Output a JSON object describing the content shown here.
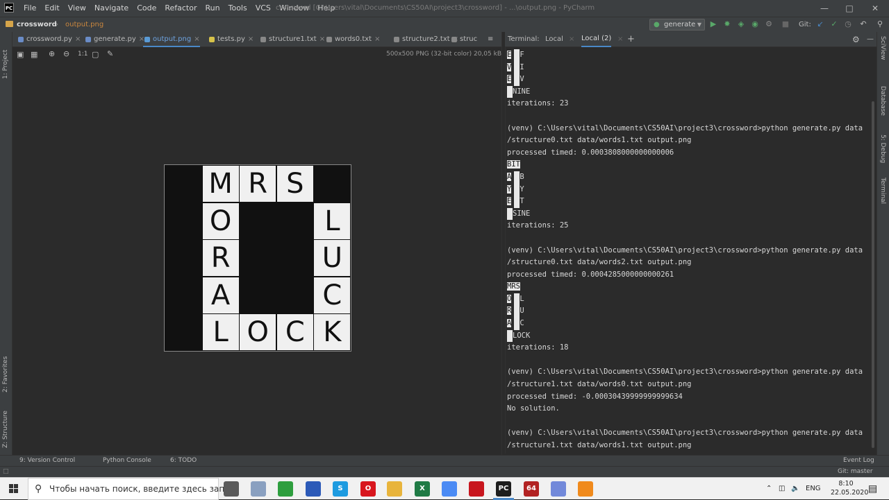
{
  "colors": {
    "accent": "#4a88c7",
    "run_green": "#59a869",
    "warning_red": "#c75450",
    "folder_orange": "#d6a54a"
  },
  "title_bar": {
    "logo": "PC",
    "menu": [
      "File",
      "Edit",
      "View",
      "Navigate",
      "Code",
      "Refactor",
      "Run",
      "Tools",
      "VCS",
      "Window",
      "Help"
    ],
    "window_title": "crossword [C:\\Users\\vital\\Documents\\CS50AI\\project3\\crossword] - ...\\output.png - PyCharm",
    "icons": [
      "minimize-icon",
      "maximize-icon",
      "close-icon"
    ]
  },
  "navbar": {
    "project": "crossword",
    "file": "output.png",
    "run_config": "generate",
    "vcs_label": "Git:"
  },
  "left_strip": {
    "project": "1: Project",
    "favorites": "2: Favorites",
    "structure": "Z: Structure"
  },
  "right_strip": {
    "sciview": "SciView",
    "database": "Database",
    "debug": "5: Debug",
    "terminal": "Terminal"
  },
  "editor_tabs": [
    {
      "label": "crossword.py",
      "icon_color": "#6a8cc7"
    },
    {
      "label": "generate.py",
      "icon_color": "#6a8cc7"
    },
    {
      "label": "output.png",
      "icon_color": "#5a9bd6"
    },
    {
      "label": "tests.py",
      "icon_color": "#d6c24a"
    },
    {
      "label": "structure1.txt",
      "icon_color": "#888888"
    },
    {
      "label": "words0.txt",
      "icon_color": "#888888"
    },
    {
      "label": "structure2.txt",
      "icon_color": "#888888"
    },
    {
      "label": "struc",
      "icon_color": "#888888"
    }
  ],
  "viewer": {
    "image_info": "500x500 PNG (32-bit color) 20,05 kB",
    "zoom_label": "1:1",
    "grid": [
      [
        "",
        "M",
        "R",
        "S",
        ""
      ],
      [
        "",
        "O",
        "",
        "",
        "L"
      ],
      [
        "",
        "R",
        "",
        "",
        "U"
      ],
      [
        "",
        "A",
        "",
        "",
        "C"
      ],
      [
        "",
        "L",
        "O",
        "C",
        "K"
      ]
    ]
  },
  "terminal": {
    "tab_title": "Terminal:",
    "tabs": [
      "Local",
      "Local (2)"
    ],
    "lines": [
      {
        "t": "cells",
        "cells": [
          [
            "E",
            1
          ],
          [
            "",
            1
          ],
          [
            "F",
            0
          ]
        ]
      },
      {
        "t": "cells",
        "cells": [
          [
            "V",
            1
          ],
          [
            "",
            1
          ],
          [
            "I",
            0
          ]
        ]
      },
      {
        "t": "cells",
        "cells": [
          [
            "E",
            1
          ],
          [
            "",
            1
          ],
          [
            "V",
            0
          ]
        ]
      },
      {
        "t": "cells",
        "cells": [
          [
            "",
            1
          ],
          [
            "NINE",
            0
          ]
        ]
      },
      {
        "t": "text",
        "text": "iterations: 23"
      },
      {
        "t": "text",
        "text": ""
      },
      {
        "t": "text",
        "text": "(venv) C:\\Users\\vital\\Documents\\CS50AI\\project3\\crossword>python generate.py data"
      },
      {
        "t": "text",
        "text": "/structure0.txt data/words1.txt output.png"
      },
      {
        "t": "text",
        "text": "processed timed: 0.0003808000000000006"
      },
      {
        "t": "cells",
        "cells": [
          [
            "BIT",
            1
          ]
        ]
      },
      {
        "t": "cells",
        "cells": [
          [
            "A",
            1
          ],
          [
            "",
            1
          ],
          [
            "B",
            0
          ]
        ]
      },
      {
        "t": "cells",
        "cells": [
          [
            "Y",
            1
          ],
          [
            "",
            1
          ],
          [
            "Y",
            0
          ]
        ]
      },
      {
        "t": "cells",
        "cells": [
          [
            "E",
            1
          ],
          [
            "",
            1
          ],
          [
            "T",
            0
          ]
        ]
      },
      {
        "t": "cells",
        "cells": [
          [
            "",
            1
          ],
          [
            "SINE",
            0
          ]
        ]
      },
      {
        "t": "text",
        "text": "iterations: 25"
      },
      {
        "t": "text",
        "text": ""
      },
      {
        "t": "text",
        "text": "(venv) C:\\Users\\vital\\Documents\\CS50AI\\project3\\crossword>python generate.py data"
      },
      {
        "t": "text",
        "text": "/structure0.txt data/words2.txt output.png"
      },
      {
        "t": "text",
        "text": "processed timed: 0.0004285000000000261"
      },
      {
        "t": "cells",
        "cells": [
          [
            "MRS",
            1
          ]
        ]
      },
      {
        "t": "cells",
        "cells": [
          [
            "O",
            1
          ],
          [
            "",
            1
          ],
          [
            "L",
            0
          ]
        ]
      },
      {
        "t": "cells",
        "cells": [
          [
            "R",
            1
          ],
          [
            "",
            1
          ],
          [
            "U",
            0
          ]
        ]
      },
      {
        "t": "cells",
        "cells": [
          [
            "A",
            1
          ],
          [
            "",
            1
          ],
          [
            "C",
            0
          ]
        ]
      },
      {
        "t": "cells",
        "cells": [
          [
            "",
            1
          ],
          [
            "LOCK",
            0
          ]
        ]
      },
      {
        "t": "text",
        "text": "iterations: 18"
      },
      {
        "t": "text",
        "text": ""
      },
      {
        "t": "text",
        "text": "(venv) C:\\Users\\vital\\Documents\\CS50AI\\project3\\crossword>python generate.py data"
      },
      {
        "t": "text",
        "text": "/structure1.txt data/words0.txt output.png"
      },
      {
        "t": "text",
        "text": "processed timed: -0.00030439999999999634"
      },
      {
        "t": "text",
        "text": "No solution."
      },
      {
        "t": "text",
        "text": ""
      },
      {
        "t": "text",
        "text": "(venv) C:\\Users\\vital\\Documents\\CS50AI\\project3\\crossword>python generate.py data"
      },
      {
        "t": "text",
        "text": "/structure1.txt data/words1.txt output.png"
      }
    ]
  },
  "bottom_tools": {
    "version_control": "9: Version Control",
    "python_console": "Python Console",
    "todo": "6: TODO",
    "event_log": "Event Log"
  },
  "status": {
    "branch": "Git: master"
  },
  "taskbar": {
    "search_placeholder": "Чтобы начать поиск, введите здесь запрос",
    "apps": [
      {
        "name": "task-view-icon",
        "label": "",
        "color": "#5a5a5a"
      },
      {
        "name": "photos-icon",
        "label": "",
        "color": "#8aa0c0"
      },
      {
        "name": "upwork-icon",
        "label": "",
        "color": "#2e9e3e"
      },
      {
        "name": "save-icon",
        "label": "",
        "color": "#2c5ab8"
      },
      {
        "name": "skype-icon",
        "label": "S",
        "color": "#1e9be0"
      },
      {
        "name": "opera-icon",
        "label": "O",
        "color": "#d8161e"
      },
      {
        "name": "explorer-icon",
        "label": "",
        "color": "#e8b43c"
      },
      {
        "name": "excel-icon",
        "label": "X",
        "color": "#1f7a45"
      },
      {
        "name": "chrome-icon",
        "label": "",
        "color": "#4b8bf4"
      },
      {
        "name": "acrobat-icon",
        "label": "",
        "color": "#c8161e"
      },
      {
        "name": "pycharm-icon",
        "label": "PC",
        "color": "#1d1d1d"
      },
      {
        "name": "app-64-icon",
        "label": "64",
        "color": "#b22222"
      },
      {
        "name": "discord-icon",
        "label": "",
        "color": "#7289da"
      },
      {
        "name": "vlc-icon",
        "label": "",
        "color": "#f08a1c"
      }
    ],
    "lang": "ENG",
    "time": "8:10",
    "date": "22.05.2020"
  }
}
